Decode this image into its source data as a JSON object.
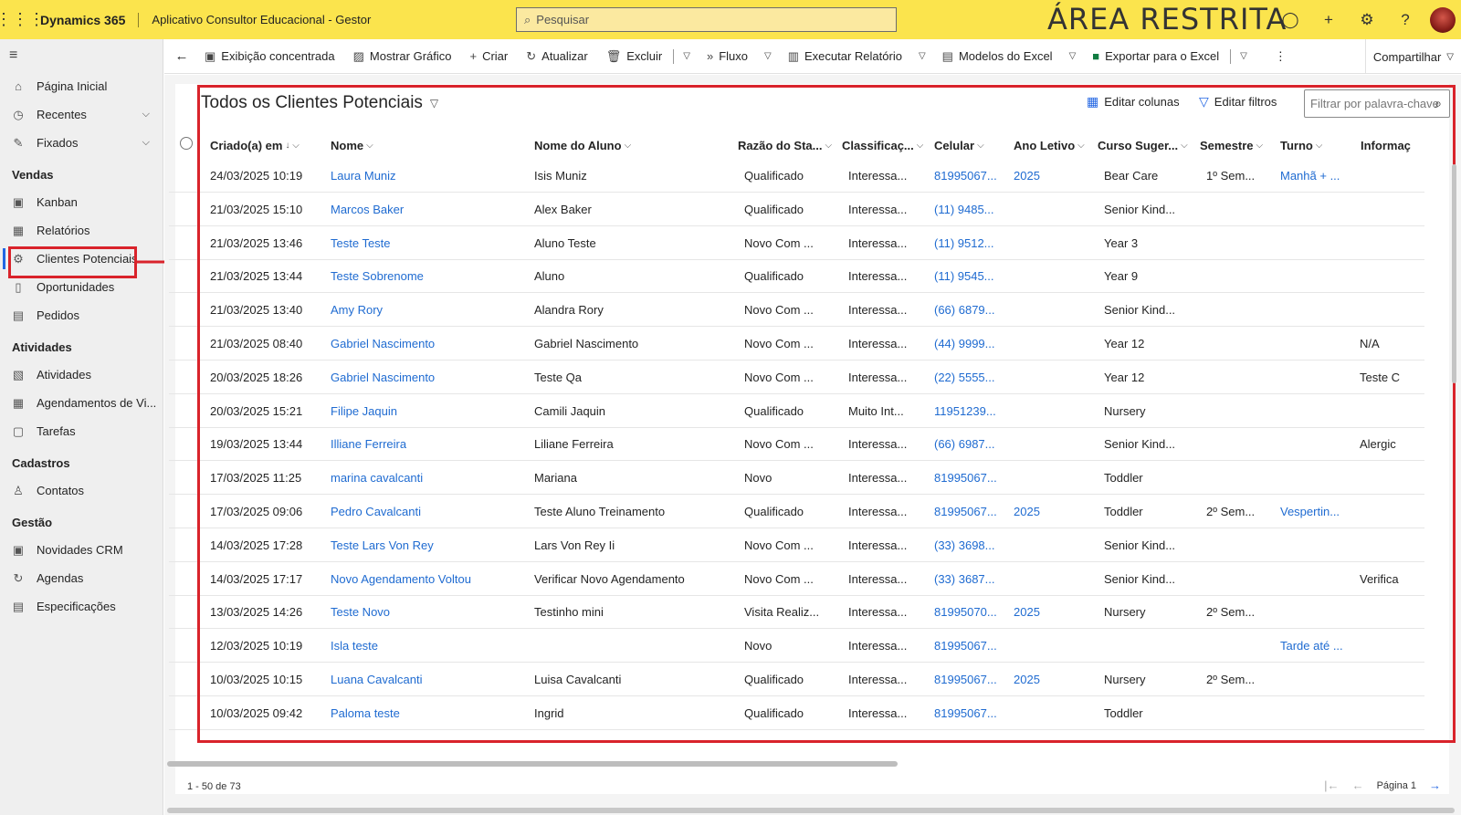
{
  "topbar": {
    "brand": "Dynamics 365",
    "app_name": "Aplicativo Consultor Educacional - Gestor",
    "search_placeholder": "Pesquisar",
    "restricted_label": "ÁREA RESTRITA"
  },
  "sidebar": {
    "items_top": [
      {
        "label": "Página Inicial",
        "icon": "home-icon"
      },
      {
        "label": "Recentes",
        "icon": "clock-icon"
      },
      {
        "label": "Fixados",
        "icon": "pin-icon"
      }
    ],
    "sections": [
      {
        "title": "Vendas",
        "items": [
          {
            "label": "Kanban",
            "icon": "kanban-icon"
          },
          {
            "label": "Relatórios",
            "icon": "report-icon"
          },
          {
            "label": "Clientes Potenciais",
            "icon": "leads-icon",
            "active": true
          },
          {
            "label": "Oportunidades",
            "icon": "opportunity-icon"
          },
          {
            "label": "Pedidos",
            "icon": "orders-icon"
          }
        ]
      },
      {
        "title": "Atividades",
        "items": [
          {
            "label": "Atividades",
            "icon": "activities-icon"
          },
          {
            "label": "Agendamentos de Vi...",
            "icon": "calendar-icon"
          },
          {
            "label": "Tarefas",
            "icon": "tasks-icon"
          }
        ]
      },
      {
        "title": "Cadastros",
        "items": [
          {
            "label": "Contatos",
            "icon": "contact-icon"
          }
        ]
      },
      {
        "title": "Gestão",
        "items": [
          {
            "label": "Novidades CRM",
            "icon": "news-icon"
          },
          {
            "label": "Agendas",
            "icon": "agenda-icon"
          },
          {
            "label": "Especificações",
            "icon": "spec-icon"
          }
        ]
      }
    ]
  },
  "commands": {
    "focused_view": "Exibição concentrada",
    "show_chart": "Mostrar Gráfico",
    "create": "Criar",
    "refresh": "Atualizar",
    "delete": "Excluir",
    "flow": "Fluxo",
    "run_report": "Executar Relatório",
    "excel_templates": "Modelos do Excel",
    "export_excel": "Exportar para o Excel",
    "share": "Compartilhar"
  },
  "view": {
    "title": "Todos os Clientes Potenciais",
    "edit_columns": "Editar colunas",
    "edit_filters": "Editar filtros",
    "filter_placeholder": "Filtrar por palavra-chave"
  },
  "columns": [
    "Criado(a) em",
    "Nome",
    "Nome do Aluno",
    "Razão do Sta...",
    "Classificaç...",
    "Celular",
    "Ano Letivo",
    "Curso Suger...",
    "Semestre",
    "Turno",
    "Informaç"
  ],
  "rows": [
    {
      "created": "24/03/2025 10:19",
      "name": "Laura Muniz",
      "student": "Isis Muniz",
      "status": "Qualificado",
      "rating": "Interessa...",
      "phone": "81995067...",
      "year": "2025",
      "course": "Bear Care",
      "semester": "1º Sem...",
      "shift": "Manhã + ...",
      "info": ""
    },
    {
      "created": "21/03/2025 15:10",
      "name": "Marcos Baker",
      "student": "Alex Baker",
      "status": "Qualificado",
      "rating": "Interessa...",
      "phone": "(11) 9485...",
      "year": "",
      "course": "Senior Kind...",
      "semester": "",
      "shift": "",
      "info": ""
    },
    {
      "created": "21/03/2025 13:46",
      "name": "Teste Teste",
      "student": "Aluno Teste",
      "status": "Novo Com ...",
      "rating": "Interessa...",
      "phone": "(11) 9512...",
      "year": "",
      "course": "Year 3",
      "semester": "",
      "shift": "",
      "info": ""
    },
    {
      "created": "21/03/2025 13:44",
      "name": "Teste Sobrenome",
      "student": "Aluno",
      "status": "Qualificado",
      "rating": "Interessa...",
      "phone": "(11) 9545...",
      "year": "",
      "course": "Year 9",
      "semester": "",
      "shift": "",
      "info": ""
    },
    {
      "created": "21/03/2025 13:40",
      "name": "Amy Rory",
      "student": "Alandra Rory",
      "status": "Novo Com ...",
      "rating": "Interessa...",
      "phone": "(66) 6879...",
      "year": "",
      "course": "Senior Kind...",
      "semester": "",
      "shift": "",
      "info": ""
    },
    {
      "created": "21/03/2025 08:40",
      "name": "Gabriel Nascimento",
      "student": "Gabriel Nascimento",
      "status": "Novo Com ...",
      "rating": "Interessa...",
      "phone": "(44) 9999...",
      "year": "",
      "course": "Year 12",
      "semester": "",
      "shift": "",
      "info": "N/A"
    },
    {
      "created": "20/03/2025 18:26",
      "name": "Gabriel Nascimento",
      "student": "Teste Qa",
      "status": "Novo Com ...",
      "rating": "Interessa...",
      "phone": "(22) 5555...",
      "year": "",
      "course": "Year 12",
      "semester": "",
      "shift": "",
      "info": "Teste C"
    },
    {
      "created": "20/03/2025 15:21",
      "name": "Filipe Jaquin",
      "student": "Camili Jaquin",
      "status": "Qualificado",
      "rating": "Muito Int...",
      "phone": "11951239...",
      "year": "",
      "course": "Nursery",
      "semester": "",
      "shift": "",
      "info": ""
    },
    {
      "created": "19/03/2025 13:44",
      "name": "Illiane Ferreira",
      "student": "Liliane Ferreira",
      "status": "Novo Com ...",
      "rating": "Interessa...",
      "phone": "(66) 6987...",
      "year": "",
      "course": "Senior Kind...",
      "semester": "",
      "shift": "",
      "info": "Alergic"
    },
    {
      "created": "17/03/2025 11:25",
      "name": "marina cavalcanti",
      "student": "Mariana",
      "status": "Novo",
      "rating": "Interessa...",
      "phone": "81995067...",
      "year": "",
      "course": "Toddler",
      "semester": "",
      "shift": "",
      "info": ""
    },
    {
      "created": "17/03/2025 09:06",
      "name": "Pedro Cavalcanti",
      "student": "Teste Aluno Treinamento",
      "status": "Qualificado",
      "rating": "Interessa...",
      "phone": "81995067...",
      "year": "2025",
      "course": "Toddler",
      "semester": "2º Sem...",
      "shift": "Vespertin...",
      "info": ""
    },
    {
      "created": "14/03/2025 17:28",
      "name": "Teste Lars Von Rey",
      "student": "Lars Von Rey Ii",
      "status": "Novo Com ...",
      "rating": "Interessa...",
      "phone": "(33) 3698...",
      "year": "",
      "course": "Senior Kind...",
      "semester": "",
      "shift": "",
      "info": ""
    },
    {
      "created": "14/03/2025 17:17",
      "name": "Novo Agendamento Voltou",
      "student": "Verificar Novo Agendamento",
      "status": "Novo Com ...",
      "rating": "Interessa...",
      "phone": "(33) 3687...",
      "year": "",
      "course": "Senior Kind...",
      "semester": "",
      "shift": "",
      "info": "Verifica"
    },
    {
      "created": "13/03/2025 14:26",
      "name": "Teste Novo",
      "student": "Testinho mini",
      "status": "Visita Realiz...",
      "rating": "Interessa...",
      "phone": "81995070...",
      "year": "2025",
      "course": "Nursery",
      "semester": "2º Sem...",
      "shift": "",
      "info": ""
    },
    {
      "created": "12/03/2025 10:19",
      "name": "Isla teste",
      "student": "",
      "status": "Novo",
      "rating": "Interessa...",
      "phone": "81995067...",
      "year": "",
      "course": "",
      "semester": "",
      "shift": "Tarde até ...",
      "info": ""
    },
    {
      "created": "10/03/2025 10:15",
      "name": "Luana Cavalcanti",
      "student": "Luisa Cavalcanti",
      "status": "Qualificado",
      "rating": "Interessa...",
      "phone": "81995067...",
      "year": "2025",
      "course": "Nursery",
      "semester": "2º Sem...",
      "shift": "",
      "info": ""
    },
    {
      "created": "10/03/2025 09:42",
      "name": "Paloma teste",
      "student": "Ingrid",
      "status": "Qualificado",
      "rating": "Interessa...",
      "phone": "81995067...",
      "year": "",
      "course": "Toddler",
      "semester": "",
      "shift": "",
      "info": ""
    }
  ],
  "footer": {
    "count": "1 - 50 de 73",
    "page": "Página 1"
  },
  "colors": {
    "topbar": "#fbe44d",
    "link": "#1f6bd1",
    "highlight": "#d9232b"
  }
}
